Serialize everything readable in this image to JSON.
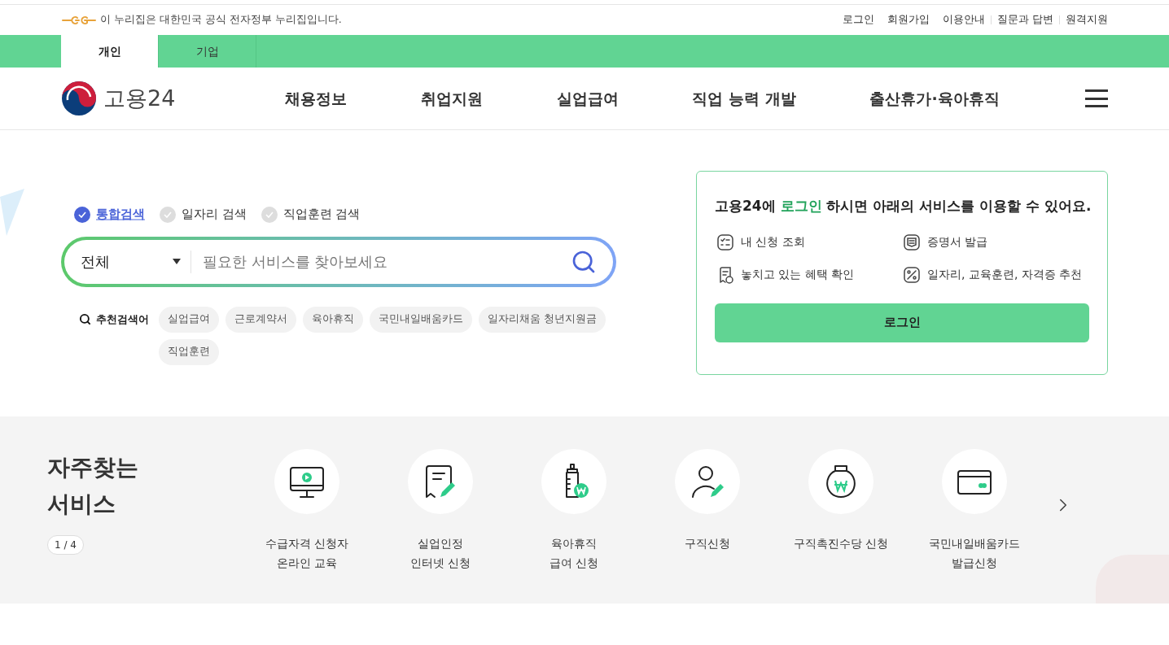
{
  "gov_banner": {
    "text": "이 누리집은 대한민국 공식 전자정부 누리집입니다."
  },
  "utility_links": [
    "로그인",
    "회원가입",
    "이용안내",
    "질문과 답변",
    "원격지원"
  ],
  "audience_tabs": [
    {
      "label": "개인",
      "selected": true
    },
    {
      "label": "기업",
      "selected": false
    }
  ],
  "logo": {
    "text": "고용24"
  },
  "main_nav": [
    "채용정보",
    "취업지원",
    "실업급여",
    "직업 능력 개발",
    "출산휴가·육아휴직"
  ],
  "search": {
    "modes": [
      {
        "label": "통합검색",
        "selected": true
      },
      {
        "label": "일자리 검색",
        "selected": false
      },
      {
        "label": "직업훈련 검색",
        "selected": false
      }
    ],
    "category": "전체",
    "placeholder": "필요한 서비스를 찾아보세요",
    "recommended_label": "추천검색어",
    "keywords": [
      "실업급여",
      "근로계약서",
      "육아휴직",
      "국민내일배움카드",
      "일자리채움 청년지원금",
      "직업훈련"
    ]
  },
  "login_card": {
    "message_before": "고용24에 ",
    "message_highlight": "로그인",
    "message_after": " 하시면 아래의 서비스를 이용할 수 있어요.",
    "features": [
      "내 신청 조회",
      "증명서 발급",
      "놓치고 있는 혜택 확인",
      "일자리, 교육훈련, 자격증 추천"
    ],
    "button": "로그인"
  },
  "frequent_services": {
    "title": "자주찾는 서비스",
    "pager": "1 / 4",
    "items": [
      "수급자격 신청자\n온라인 교육",
      "실업인정\n인터넷 신청",
      "육아휴직\n급여 신청",
      "구직신청",
      "구직촉진수당 신청",
      "국민내일배움카드\n발급신청"
    ]
  }
}
